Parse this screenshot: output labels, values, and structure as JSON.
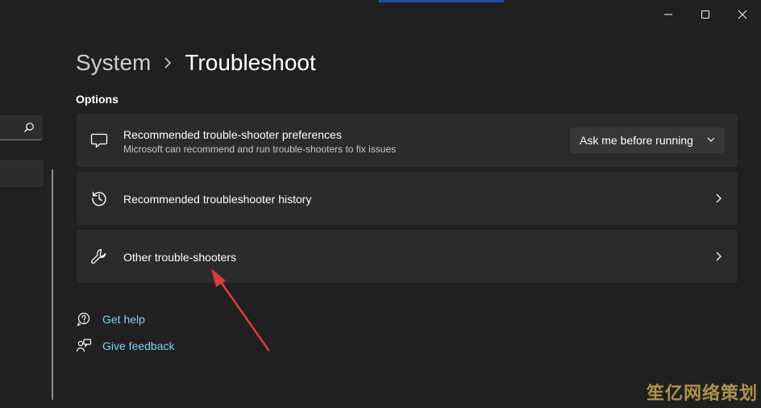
{
  "window": {
    "controls": [
      "minimize",
      "maximize",
      "close"
    ]
  },
  "header": {
    "parent": "System",
    "current": "Troubleshoot"
  },
  "section": {
    "label": "Options"
  },
  "cards": [
    {
      "title": "Recommended trouble-shooter preferences",
      "description": "Microsoft can recommend and run trouble-shooters to fix issues",
      "dropdown_value": "Ask me before running",
      "icon": "chat-bubble-icon"
    },
    {
      "title": "Recommended troubleshooter history",
      "icon": "history-icon"
    },
    {
      "title": "Other trouble-shooters",
      "icon": "wrench-icon"
    }
  ],
  "links": [
    {
      "label": "Get help",
      "icon": "help-icon"
    },
    {
      "label": "Give feedback",
      "icon": "feedback-icon"
    }
  ],
  "watermark": "笙亿网络策划",
  "colors": {
    "background": "#202020",
    "card": "#2b2b2b",
    "link": "#7fd2f0",
    "annotation_arrow": "#e03a3a"
  }
}
